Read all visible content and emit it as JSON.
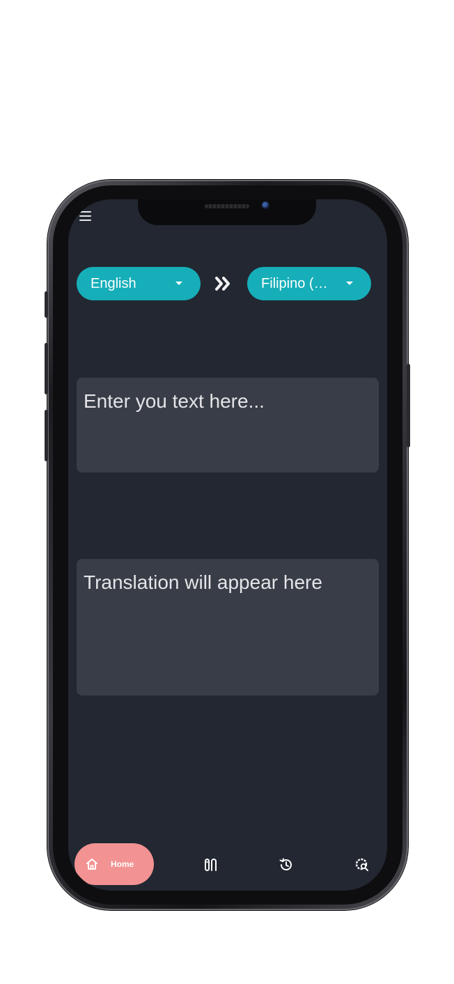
{
  "app": {
    "source_language": "English",
    "target_language": "Filipino (T...",
    "input_placeholder": "Enter you text here...",
    "output_placeholder": "Translation will appear here"
  },
  "icons": {
    "menu": "hamburger-menu-icon",
    "swap": "double-chevron-right-icon",
    "home": "home-icon",
    "phrasebook": "phrasebook-icon",
    "history": "history-icon",
    "settings": "settings-search-icon"
  },
  "bottom_nav": {
    "items": [
      {
        "label": "Home",
        "active": true
      },
      {
        "label": "",
        "active": false
      },
      {
        "label": "",
        "active": false
      },
      {
        "label": "",
        "active": false
      }
    ]
  },
  "colors": {
    "background": "#222731",
    "accent": "#16aeb9",
    "text_box": "#393d47",
    "home_active": "#f29292"
  }
}
